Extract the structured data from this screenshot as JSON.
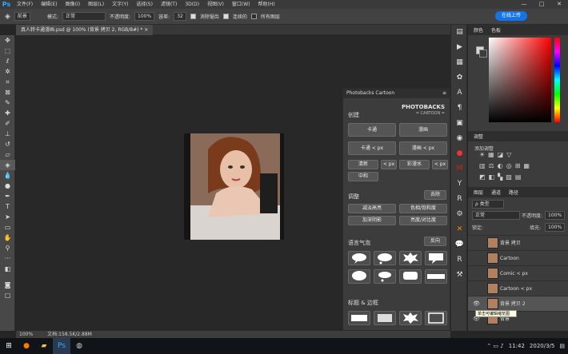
{
  "app": {
    "logo": "Ps"
  },
  "menubar": {
    "items": [
      "文件(F)",
      "编辑(E)",
      "图像(I)",
      "图层(L)",
      "文字(Y)",
      "选择(S)",
      "滤镜(T)",
      "3D(D)",
      "视图(V)",
      "窗口(W)",
      "帮助(H)"
    ],
    "minimize": "—",
    "restore": "□",
    "close": "✕"
  },
  "options": {
    "preset": "前景",
    "mode_label": "模式:",
    "mode_value": "正常",
    "opacity_label": "不透明度:",
    "opacity_value": "100%",
    "tolerance_label": "容差:",
    "tolerance_value": "32",
    "antialias": "消除锯齿",
    "contiguous": "连续的",
    "all_layers": "所有图层",
    "share": "在线上传"
  },
  "document": {
    "tab": "真人转卡通漫画.psd @ 100% (背景 拷贝 2, RGB/8#) *",
    "close": "×"
  },
  "status": {
    "zoom": "100%",
    "doc": "文档:158.5K/2.88M"
  },
  "plugin": {
    "title": "Photobacks Cartoon",
    "logo_top": "PHOTOBACKS",
    "logo_bottom": "= CARTOON =",
    "create": "创建",
    "btn_cartoon": "卡通",
    "btn_comic": "漫画",
    "btn_cartoon_px": "卡通 < px",
    "btn_comic_px": "漫画 < px",
    "btn_bw": "清新",
    "btn_lt_px": "< px",
    "btn_watercolor": "彩漫水",
    "btn_lt2": "< px",
    "btn_mid": "中和",
    "adjust": "调整",
    "reset": "去除",
    "adj1": "减淡高亮",
    "adj2": "色相/饱和度",
    "adj3": "加深阴影",
    "adj4": "亮度/对比度",
    "bubbles": "语言气泡",
    "reverse": "反向",
    "titles": "标题 & 边框"
  },
  "color_panel": {
    "tab1": "颜色",
    "tab2": "色板"
  },
  "adjust_panel": {
    "title": "调整",
    "add": "添加调整"
  },
  "layers_panel": {
    "tab1": "图层",
    "tab2": "通道",
    "tab3": "路径",
    "kind": "ρ 类型",
    "blend": "正常",
    "opacity_label": "不透明度:",
    "opacity": "100%",
    "lock_label": "锁定:",
    "fill_label": "填充:",
    "fill": "100%",
    "layers": [
      "背景 拷贝",
      "Cartoon",
      "Comic < px",
      "Cartoon < px",
      "背景 拷贝 2",
      "背景"
    ]
  },
  "tooltip": "单击可编辑缩览图",
  "taskbar": {
    "clock": "11:42",
    "date": "2020/3/5"
  }
}
